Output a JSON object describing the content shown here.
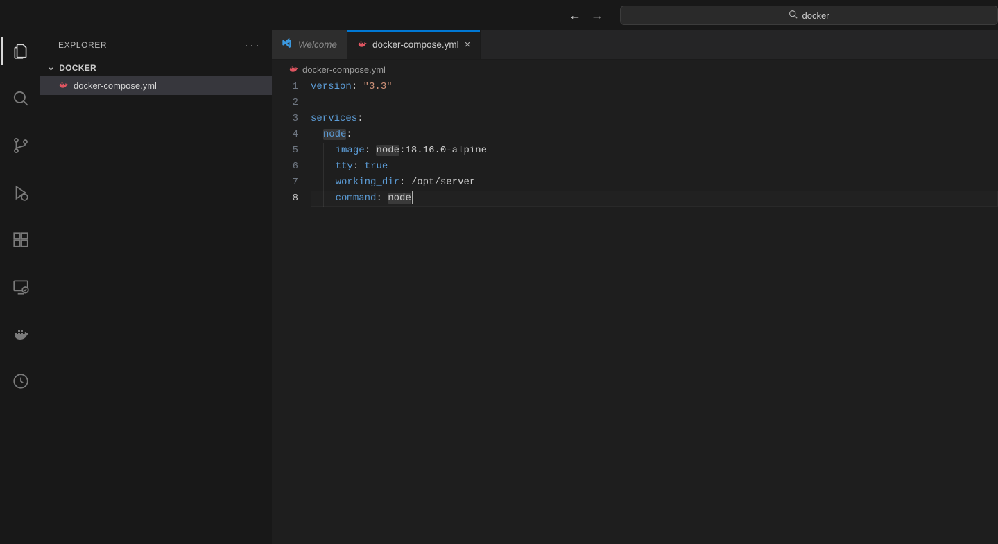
{
  "titlebar": {
    "nav_back_enabled": true,
    "nav_forward_enabled": false,
    "search_text": "docker"
  },
  "activity_bar": {
    "items": [
      {
        "name": "explorer",
        "active": true
      },
      {
        "name": "search",
        "active": false
      },
      {
        "name": "source-control",
        "active": false
      },
      {
        "name": "run-debug",
        "active": false
      },
      {
        "name": "extensions",
        "active": false
      },
      {
        "name": "remote",
        "active": false
      },
      {
        "name": "docker",
        "active": false
      },
      {
        "name": "testing",
        "active": false
      }
    ]
  },
  "sidebar": {
    "title": "EXPLORER",
    "folder_name": "DOCKER",
    "files": [
      {
        "name": "docker-compose.yml",
        "icon": "docker-icon",
        "active": true
      }
    ]
  },
  "tabs": [
    {
      "label": "Welcome",
      "icon": "vscode-icon",
      "active": false,
      "italic": true,
      "closable": false
    },
    {
      "label": "docker-compose.yml",
      "icon": "docker-icon",
      "active": true,
      "italic": false,
      "closable": true
    }
  ],
  "breadcrumb": {
    "icon": "docker-icon",
    "label": "docker-compose.yml"
  },
  "editor": {
    "current_line": 8,
    "highlight_word": "node",
    "lines": [
      {
        "n": 1,
        "tokens": [
          {
            "t": "version",
            "c": "k"
          },
          {
            "t": ": ",
            "c": "c"
          },
          {
            "t": "\"3.3\"",
            "c": "s"
          }
        ]
      },
      {
        "n": 2,
        "tokens": []
      },
      {
        "n": 3,
        "tokens": [
          {
            "t": "services",
            "c": "k"
          },
          {
            "t": ":",
            "c": "c"
          }
        ]
      },
      {
        "n": 4,
        "indent": 1,
        "tokens": [
          {
            "t": "node",
            "c": "k",
            "hl": true
          },
          {
            "t": ":",
            "c": "c"
          }
        ]
      },
      {
        "n": 5,
        "indent": 2,
        "tokens": [
          {
            "t": "image",
            "c": "k"
          },
          {
            "t": ": ",
            "c": "c"
          },
          {
            "t": "node",
            "c": "p",
            "hl": true
          },
          {
            "t": ":18.16.0-alpine",
            "c": "p"
          }
        ]
      },
      {
        "n": 6,
        "indent": 2,
        "tokens": [
          {
            "t": "tty",
            "c": "k"
          },
          {
            "t": ": ",
            "c": "c"
          },
          {
            "t": "true",
            "c": "k"
          }
        ]
      },
      {
        "n": 7,
        "indent": 2,
        "tokens": [
          {
            "t": "working_dir",
            "c": "k"
          },
          {
            "t": ": ",
            "c": "c"
          },
          {
            "t": "/opt/server",
            "c": "p"
          }
        ]
      },
      {
        "n": 8,
        "indent": 2,
        "tokens": [
          {
            "t": "command",
            "c": "k"
          },
          {
            "t": ": ",
            "c": "c"
          },
          {
            "t": "node",
            "c": "p",
            "hl": true
          }
        ],
        "cursor_after": true
      }
    ]
  }
}
